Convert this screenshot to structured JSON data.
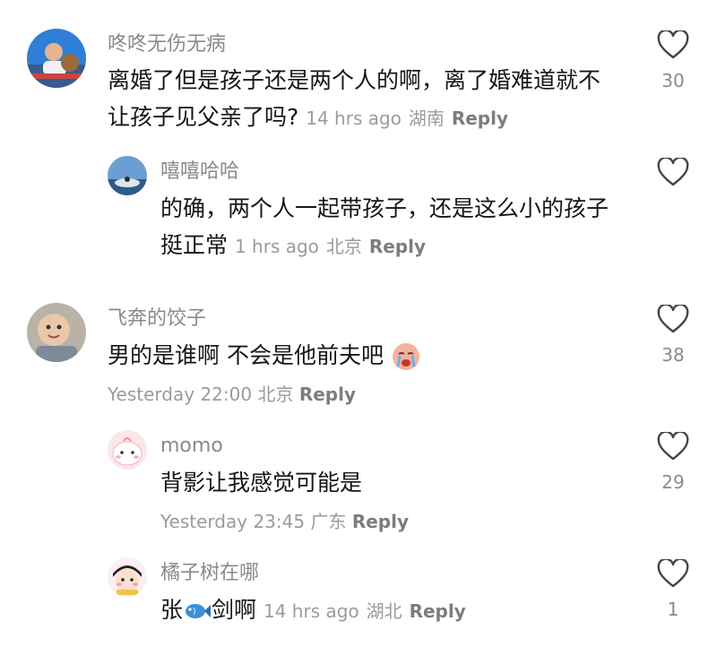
{
  "comments": [
    {
      "username": "咚咚无伤无病",
      "text_line1": "离婚了但是孩子还是两个人的啊，离了婚难道就不",
      "text_line2": "让孩子见父亲了吗?",
      "time": "14 hrs ago",
      "location": "湖南",
      "reply": "Reply",
      "likes": "30",
      "avatar": "photo-boy-avatar"
    },
    {
      "username": "嘻嘻哈哈",
      "text_line1": "的确，两个人一起带孩子，还是这么小的孩子",
      "text_line2": "挺正常",
      "time": "1 hrs ago",
      "location": "北京",
      "reply": "Reply",
      "likes": "",
      "avatar": "sky-photo-avatar"
    },
    {
      "username": "飞奔的饺子",
      "text_line1": "男的是谁啊 不会是他前夫吧",
      "emoji": "crying-face-emoji",
      "time": "Yesterday 22:00",
      "location": "北京",
      "reply": "Reply",
      "likes": "38",
      "avatar": "baby-photo-avatar"
    },
    {
      "username": "momo",
      "text_line1": "背影让我感觉可能是",
      "time": "Yesterday 23:45",
      "location": "广东",
      "reply": "Reply",
      "likes": "29",
      "avatar": "cartoon-bun-avatar"
    },
    {
      "username": "橘子树在哪",
      "text_prefix": "张",
      "emoji": "fish-emoji",
      "text_suffix": "剑啊",
      "time": "14 hrs ago",
      "location": "湖北",
      "reply": "Reply",
      "likes": "1",
      "avatar": "cartoon-girl-avatar"
    }
  ],
  "colors": {
    "username": "#8a8a8a",
    "text": "#161616",
    "meta": "#9b9b9b"
  }
}
